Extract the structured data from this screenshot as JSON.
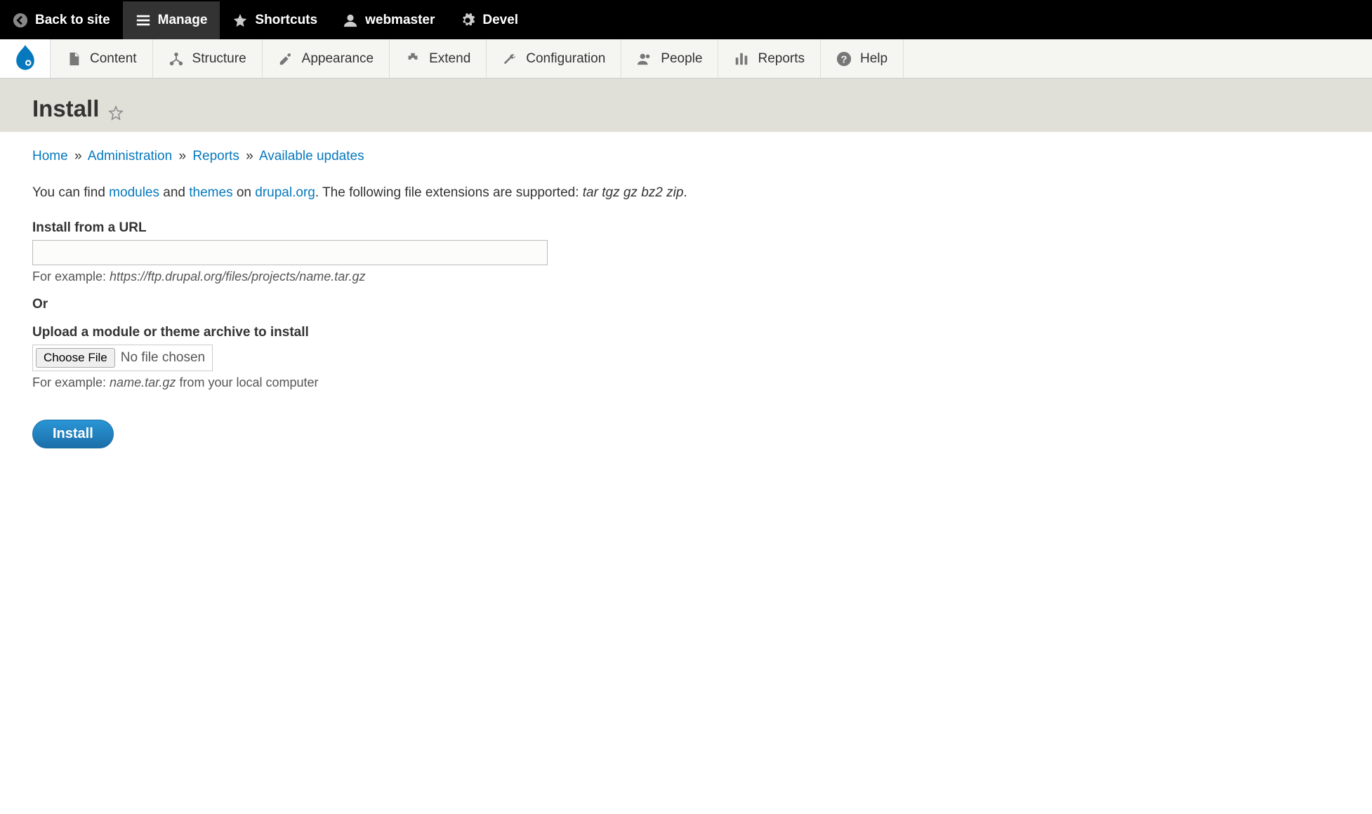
{
  "toolbar_top": {
    "back": "Back to site",
    "manage": "Manage",
    "shortcuts": "Shortcuts",
    "user": "webmaster",
    "devel": "Devel"
  },
  "admin_menu": {
    "content": "Content",
    "structure": "Structure",
    "appearance": "Appearance",
    "extend": "Extend",
    "configuration": "Configuration",
    "people": "People",
    "reports": "Reports",
    "help": "Help"
  },
  "page": {
    "title": "Install"
  },
  "breadcrumb": {
    "home": "Home",
    "admin": "Administration",
    "reports": "Reports",
    "updates": "Available updates",
    "sep": "»"
  },
  "intro": {
    "pre": "You can find ",
    "modules": "modules",
    "and": " and ",
    "themes": "themes",
    "on": " on ",
    "drupal": "drupal.org",
    "post": ". The following file extensions are supported: ",
    "ext": "tar tgz gz bz2 zip",
    "dot": "."
  },
  "form": {
    "url_label": "Install from a URL",
    "url_value": "",
    "url_desc_pre": "For example: ",
    "url_desc_em": "https://ftp.drupal.org/files/projects/name.tar.gz",
    "or": "Or",
    "upload_label": "Upload a module or theme archive to install",
    "choose": "Choose File",
    "nofile": "No file chosen",
    "upload_desc_pre": "For example: ",
    "upload_desc_em": "name.tar.gz",
    "upload_desc_post": " from your local computer",
    "submit": "Install"
  }
}
